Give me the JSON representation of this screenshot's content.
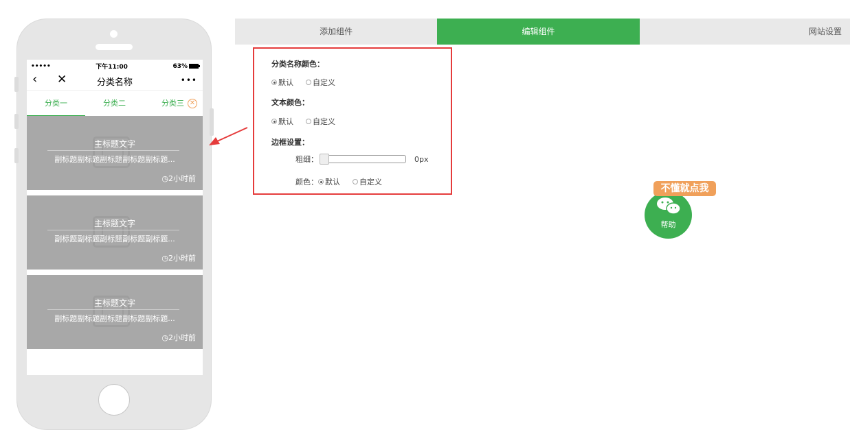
{
  "phone": {
    "status": {
      "signal": "•••••",
      "time": "下午11:00",
      "battery": "63%"
    },
    "nav": {
      "back": "‹",
      "close": "✕",
      "title": "分类名称",
      "more": "•••"
    },
    "tabs": [
      "分类一",
      "分类二",
      "分类三"
    ],
    "cards": [
      {
        "title": "主标题文字",
        "subtitle": "副标题副标题副标题副标题副标题...",
        "time": "◷2小时前"
      },
      {
        "title": "主标题文字",
        "subtitle": "副标题副标题副标题副标题副标题...",
        "time": "◷2小时前"
      },
      {
        "title": "主标题文字",
        "subtitle": "副标题副标题副标题副标题副标题...",
        "time": "◷2小时前"
      }
    ]
  },
  "top_tabs": [
    "添加组件",
    "编辑组件",
    "网站设置"
  ],
  "settings": {
    "category_color_label": "分类名称颜色：",
    "text_color_label": "文本颜色：",
    "border_label": "边框设置：",
    "thickness_label": "粗细：",
    "thickness_value": "0px",
    "color_label": "颜色：",
    "default": "默认",
    "custom": "自定义"
  },
  "help": {
    "tag": "不懂就点我",
    "label": "帮助"
  },
  "colors": {
    "accent": "#3daf51",
    "highlight": "#e53b3b",
    "tag": "#f0a05a"
  }
}
